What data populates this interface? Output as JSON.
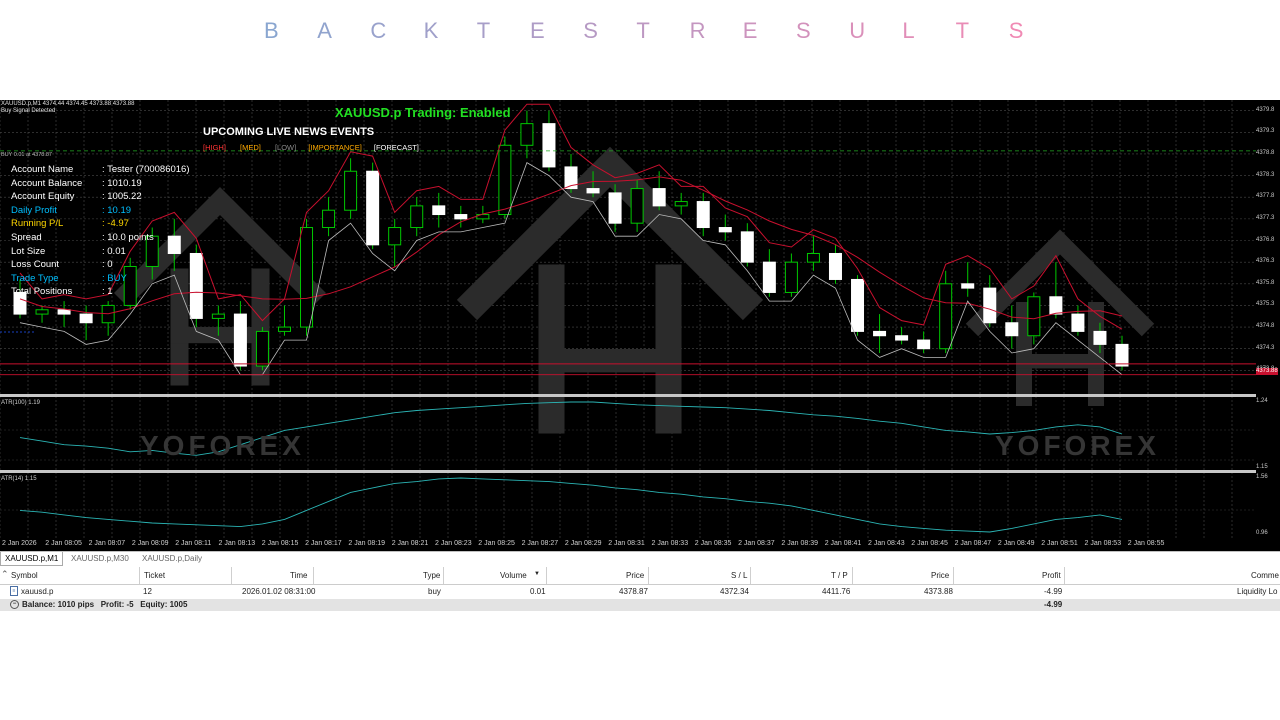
{
  "header_title": [
    "B",
    "A",
    "C",
    "K",
    "T",
    "E",
    "S",
    "T",
    "R",
    "E",
    "S",
    "U",
    "L",
    "T",
    "S"
  ],
  "chart": {
    "symbol_info": "XAUUSD.p,M1  4374.44 4374.45 4373.88 4373.88",
    "signal_text": "Buy Signal Detected",
    "trading_status": "XAUUSD.p Trading: Enabled",
    "news_title": "UPCOMING LIVE NEWS EVENTS",
    "news_legend": {
      "high": "[HIGH]",
      "med": "[MED]",
      "low": "[LOW]",
      "importance": "[IMPORTANCE]",
      "forecast": "[FORECAST]"
    },
    "buy_line_label": "BUY 0.01 at 4378.87",
    "watermark": "YOFOREX",
    "atr1_label": "ATR(100) 1.19",
    "atr2_label": "ATR(14) 1.15",
    "atr1_max": "1.24",
    "atr1_min": "1.15",
    "atr2_max": "1.56",
    "atr2_min": "0.96",
    "current_price": "4373.88",
    "price_ticks": [
      "4379.8",
      "4379.3",
      "4378.8",
      "4378.3",
      "4377.8",
      "4377.3",
      "4376.8",
      "4376.3",
      "4375.8",
      "4375.3",
      "4374.8",
      "4374.3",
      "4373.8"
    ],
    "time_ticks": [
      "2 Jan 2026",
      "2 Jan 08:05",
      "2 Jan 08:07",
      "2 Jan 08:09",
      "2 Jan 08:11",
      "2 Jan 08:13",
      "2 Jan 08:15",
      "2 Jan 08:17",
      "2 Jan 08:19",
      "2 Jan 08:21",
      "2 Jan 08:23",
      "2 Jan 08:25",
      "2 Jan 08:27",
      "2 Jan 08:29",
      "2 Jan 08:31",
      "2 Jan 08:33",
      "2 Jan 08:35",
      "2 Jan 08:37",
      "2 Jan 08:39",
      "2 Jan 08:41",
      "2 Jan 08:43",
      "2 Jan 08:45",
      "2 Jan 08:47",
      "2 Jan 08:49",
      "2 Jan 08:51",
      "2 Jan 08:53",
      "2 Jan 08:55"
    ],
    "info_panel": [
      {
        "label": "Account Name",
        "value": "Tester (700086016)",
        "color": "#ffffff"
      },
      {
        "label": "Account Balance",
        "value": "1010.19",
        "color": "#ffffff"
      },
      {
        "label": "Account Equity",
        "value": "1005.22",
        "color": "#ffffff"
      },
      {
        "label": "Daily Profit",
        "value": "10.19",
        "color": "#00bfff"
      },
      {
        "label": "Running P/L",
        "value": "-4.97",
        "color": "#ffd700"
      },
      {
        "label": "Spread",
        "value": "10.0 points",
        "color": "#ffffff"
      },
      {
        "label": "Lot Size",
        "value": "0.01",
        "color": "#ffffff"
      },
      {
        "label": "Loss Count",
        "value": "0",
        "color": "#ffffff"
      },
      {
        "label": "Trade Type",
        "value": "BUY",
        "color": "#00bfff"
      },
      {
        "label": "Total Positions",
        "value": "1",
        "color": "#ffffff"
      }
    ],
    "candles": [
      [
        4375.6,
        4375.9,
        4375.0,
        4375.1
      ],
      [
        4375.1,
        4375.3,
        4374.9,
        4375.2
      ],
      [
        4375.2,
        4375.4,
        4374.8,
        4375.1
      ],
      [
        4375.1,
        4375.3,
        4374.5,
        4374.9
      ],
      [
        4374.9,
        4375.4,
        4374.6,
        4375.3
      ],
      [
        4375.3,
        4376.4,
        4375.2,
        4376.2
      ],
      [
        4376.2,
        4377.1,
        4375.9,
        4376.9
      ],
      [
        4376.9,
        4377.3,
        4376.1,
        4376.5
      ],
      [
        4376.5,
        4376.7,
        4374.8,
        4375.0
      ],
      [
        4375.0,
        4375.3,
        4374.6,
        4375.1
      ],
      [
        4375.1,
        4375.4,
        4373.8,
        4373.9
      ],
      [
        4373.9,
        4374.8,
        4373.8,
        4374.7
      ],
      [
        4374.7,
        4375.3,
        4374.6,
        4374.8
      ],
      [
        4374.8,
        4377.3,
        4374.6,
        4377.1
      ],
      [
        4377.1,
        4377.8,
        4376.9,
        4377.5
      ],
      [
        4377.5,
        4378.7,
        4377.3,
        4378.4
      ],
      [
        4378.4,
        4378.6,
        4376.6,
        4376.7
      ],
      [
        4376.7,
        4377.3,
        4376.2,
        4377.1
      ],
      [
        4377.1,
        4377.8,
        4376.9,
        4377.6
      ],
      [
        4377.6,
        4377.9,
        4377.1,
        4377.4
      ],
      [
        4377.4,
        4377.6,
        4377.1,
        4377.3
      ],
      [
        4377.3,
        4377.6,
        4377.2,
        4377.4
      ],
      [
        4377.4,
        4379.2,
        4377.3,
        4379.0
      ],
      [
        4379.0,
        4379.8,
        4378.7,
        4379.5
      ],
      [
        4379.5,
        4379.8,
        4378.4,
        4378.5
      ],
      [
        4378.5,
        4378.8,
        4377.9,
        4378.0
      ],
      [
        4378.0,
        4378.4,
        4377.8,
        4377.9
      ],
      [
        4377.9,
        4378.1,
        4377.0,
        4377.2
      ],
      [
        4377.2,
        4378.2,
        4377.0,
        4378.0
      ],
      [
        4378.0,
        4378.4,
        4377.5,
        4377.6
      ],
      [
        4377.6,
        4377.9,
        4377.4,
        4377.7
      ],
      [
        4377.7,
        4377.9,
        4376.9,
        4377.1
      ],
      [
        4377.1,
        4377.4,
        4376.8,
        4377.0
      ],
      [
        4377.0,
        4377.2,
        4376.2,
        4376.3
      ],
      [
        4376.3,
        4376.6,
        4375.5,
        4375.6
      ],
      [
        4375.6,
        4376.5,
        4375.5,
        4376.3
      ],
      [
        4376.3,
        4376.9,
        4376.1,
        4376.5
      ],
      [
        4376.5,
        4376.7,
        4375.8,
        4375.9
      ],
      [
        4375.9,
        4376.0,
        4374.6,
        4374.7
      ],
      [
        4374.7,
        4375.1,
        4374.2,
        4374.6
      ],
      [
        4374.6,
        4374.8,
        4374.4,
        4374.5
      ],
      [
        4374.5,
        4374.7,
        4374.2,
        4374.3
      ],
      [
        4374.3,
        4376.1,
        4374.2,
        4375.8
      ],
      [
        4375.8,
        4376.3,
        4375.5,
        4375.7
      ],
      [
        4375.7,
        4376.0,
        4374.8,
        4374.9
      ],
      [
        4374.9,
        4375.3,
        4374.3,
        4374.6
      ],
      [
        4374.6,
        4375.6,
        4374.4,
        4375.5
      ],
      [
        4375.5,
        4376.3,
        4375.0,
        4375.1
      ],
      [
        4375.1,
        4375.3,
        4374.6,
        4374.7
      ],
      [
        4374.7,
        4374.9,
        4374.2,
        4374.4
      ],
      [
        4374.4,
        4374.6,
        4373.8,
        4373.9
      ]
    ],
    "atr1_values": [
      1.19,
      1.185,
      1.18,
      1.178,
      1.175,
      1.17,
      1.172,
      1.168,
      1.165,
      1.17,
      1.18,
      1.19,
      1.2,
      1.205,
      1.21,
      1.215,
      1.22,
      1.225,
      1.228,
      1.23,
      1.232,
      1.234,
      1.236,
      1.238,
      1.239,
      1.24,
      1.24,
      1.238,
      1.236,
      1.235,
      1.234,
      1.233,
      1.232,
      1.23,
      1.228,
      1.225,
      1.222,
      1.22,
      1.217,
      1.213,
      1.21,
      1.205,
      1.2,
      1.198,
      1.195,
      1.197,
      1.2,
      1.205,
      1.208,
      1.205,
      1.195
    ],
    "atr2_values": [
      1.2,
      1.18,
      1.15,
      1.12,
      1.1,
      1.08,
      1.06,
      1.05,
      1.04,
      1.03,
      1.02,
      1.05,
      1.1,
      1.2,
      1.3,
      1.4,
      1.45,
      1.5,
      1.52,
      1.55,
      1.56,
      1.55,
      1.54,
      1.53,
      1.52,
      1.5,
      1.48,
      1.45,
      1.43,
      1.4,
      1.38,
      1.35,
      1.33,
      1.3,
      1.28,
      1.25,
      1.2,
      1.15,
      1.1,
      1.05,
      1.02,
      1.0,
      0.98,
      0.97,
      0.96,
      1.0,
      1.05,
      1.1,
      1.12,
      1.15,
      1.1
    ]
  },
  "tabs": [
    "XAUUSD.p,M1",
    "XAUUSD.p,M30",
    "XAUUSD.p,Daily"
  ],
  "positions_table": {
    "headers": [
      "Symbol",
      "Ticket",
      "Time",
      "Type",
      "Volume",
      "Price",
      "S / L",
      "T / P",
      "Price",
      "Profit",
      "Comme"
    ],
    "row": {
      "symbol": "xauusd.p",
      "ticket": "12",
      "time": "2026.01.02 08:31:00",
      "type": "buy",
      "volume": "0.01",
      "price": "4378.87",
      "sl": "4372.34",
      "tp": "4411.76",
      "cur_price": "4373.88",
      "profit": "-4.99",
      "comment": "Liquidity Lo"
    },
    "balance_text": "Balance: 1010 pips   Profit: -5   Equity: 1005",
    "balance_profit": "-4.99"
  },
  "colors": {
    "title_from": "#8aa6d0",
    "title_to": "#f08ab4",
    "bull_candle": "#00c800",
    "bear_candle": "#ffffff",
    "ma_line": "#c8102e",
    "atr_line": "#2bb5b5",
    "status_green": "#22e022",
    "news_high": "#ff3333",
    "news_med": "#ffaa00",
    "news_low": "#888888"
  }
}
